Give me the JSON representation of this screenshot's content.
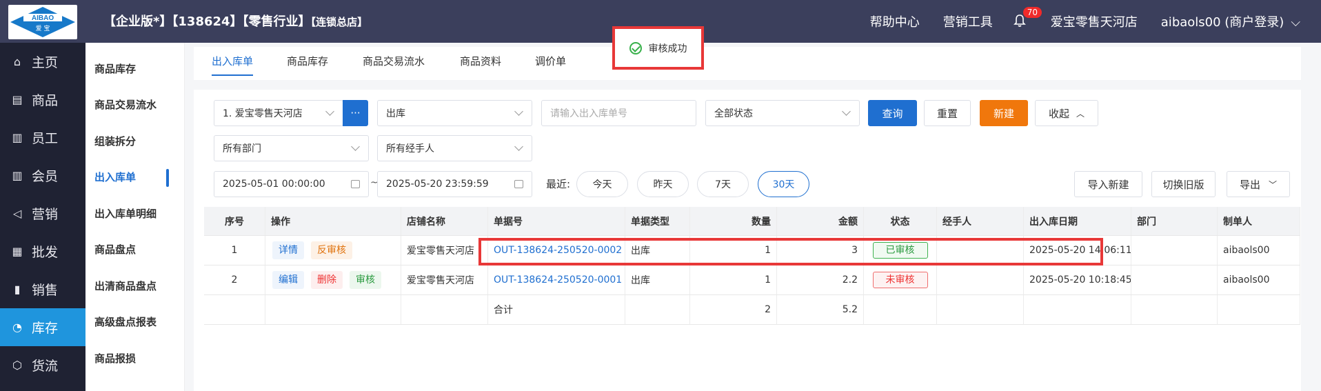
{
  "header": {
    "logo_text_top": "AIBAO",
    "logo_text_bottom": "爱 宝",
    "company_info": "【企业版*】【138624】【零售行业】",
    "store_tag": "【连锁总店】",
    "help_center": "帮助中心",
    "marketing_tools": "营销工具",
    "notification_count": "70",
    "store_name": "爱宝零售天河店",
    "user": "aibaols00 (商户登录)"
  },
  "main_nav": [
    {
      "label": "主页",
      "icon": "home-icon"
    },
    {
      "label": "商品",
      "icon": "goods-icon"
    },
    {
      "label": "员工",
      "icon": "staff-icon"
    },
    {
      "label": "会员",
      "icon": "member-icon"
    },
    {
      "label": "营销",
      "icon": "megaphone-icon"
    },
    {
      "label": "批发",
      "icon": "wholesale-icon"
    },
    {
      "label": "销售",
      "icon": "chart-icon"
    },
    {
      "label": "库存",
      "icon": "inventory-icon"
    },
    {
      "label": "货流",
      "icon": "cube-icon"
    }
  ],
  "sub_nav": [
    "商品库存",
    "商品交易流水",
    "组装拆分",
    "出入库单",
    "出入库单明细",
    "商品盘点",
    "出清商品盘点",
    "高级盘点报表",
    "商品报损"
  ],
  "tabs": [
    "出入库单",
    "商品库存",
    "商品交易流水",
    "商品资料",
    "调价单"
  ],
  "toast": "审核成功",
  "filters": {
    "store": "1. 爱宝零售天河店",
    "more": "···",
    "direction": "出库",
    "order_no_placeholder": "请输入出入库单号",
    "status": "全部状态",
    "query": "查询",
    "reset": "重置",
    "create": "新建",
    "collapse": "收起",
    "department": "所有部门",
    "handler": "所有经手人",
    "date_start": "2025-05-01 00:00:00",
    "date_sep": "~",
    "date_end": "2025-05-20 23:59:59",
    "recent_label": "最近:",
    "recent": [
      "今天",
      "昨天",
      "7天",
      "30天"
    ],
    "import_create": "导入新建",
    "switch_old": "切换旧版",
    "export": "导出"
  },
  "table": {
    "columns": [
      "序号",
      "操作",
      "店铺名称",
      "单据号",
      "单据类型",
      "数量",
      "金额",
      "状态",
      "经手人",
      "出入库日期",
      "部门",
      "制单人"
    ],
    "rows": [
      {
        "index": "1",
        "actions": [
          "详情",
          "反审核"
        ],
        "store": "爱宝零售天河店",
        "order_no": "OUT-138624-250520-0002",
        "type": "出库",
        "qty": "1",
        "amount": "3",
        "status": "已审核",
        "handler": "",
        "date": "2025-05-20 14:06:11",
        "dept": "",
        "creator": "aibaols00"
      },
      {
        "index": "2",
        "actions": [
          "编辑",
          "删除",
          "审核"
        ],
        "store": "爱宝零售天河店",
        "order_no": "OUT-138624-250520-0001",
        "type": "出库",
        "qty": "1",
        "amount": "2.2",
        "status": "未审核",
        "handler": "",
        "date": "2025-05-20 10:18:45",
        "dept": "",
        "creator": "aibaols00"
      }
    ],
    "total": {
      "label": "合计",
      "qty": "2",
      "amount": "5.2"
    }
  },
  "colors": {
    "topbar": "#3b3f5c",
    "sidenav": "#1f2233",
    "active_nav": "#1f95dd",
    "primary": "#1f6fd0",
    "orange": "#f0770c",
    "highlight": "#e83838"
  }
}
